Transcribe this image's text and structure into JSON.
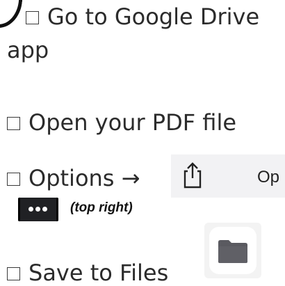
{
  "checklist": {
    "step1_line1": "Go to Google Drive",
    "step1_line2": "app",
    "step2": "Open your PDF file",
    "step3_text": "Options →",
    "step3_note": "(top right)",
    "step4": "Save to Files"
  },
  "share_sheet": {
    "partial_label": "Op",
    "icon": "share-icon"
  },
  "more_button": {
    "icon": "more-horizontal-icon"
  },
  "files_app": {
    "icon": "folder-icon",
    "color": "#5a5a60"
  }
}
